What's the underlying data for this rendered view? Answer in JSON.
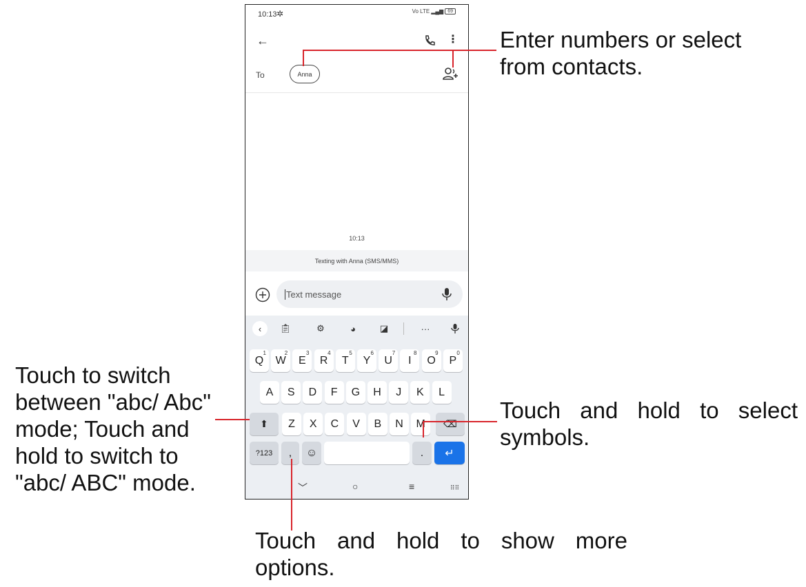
{
  "status_bar": {
    "time": "10:13",
    "network": "Vo LTE",
    "battery": "69"
  },
  "recipients": {
    "to_label": "To",
    "chip": "Anna"
  },
  "thread": {
    "timestamp": "10:13",
    "texting_with": "Texting with Anna (SMS/MMS)"
  },
  "composer": {
    "placeholder": "Text message"
  },
  "keyboard": {
    "row1": [
      "Q",
      "W",
      "E",
      "R",
      "T",
      "Y",
      "U",
      "I",
      "O",
      "P"
    ],
    "row1_digits": [
      "1",
      "2",
      "3",
      "4",
      "5",
      "6",
      "7",
      "8",
      "9",
      "0"
    ],
    "row2": [
      "A",
      "S",
      "D",
      "F",
      "G",
      "H",
      "J",
      "K",
      "L"
    ],
    "row3": [
      "Z",
      "X",
      "C",
      "V",
      "B",
      "N",
      "M"
    ],
    "symbols_key": "?123",
    "comma_key": ",",
    "period_key": "."
  },
  "annotations": {
    "top": "Enter numbers or select from contacts.",
    "right": "Touch and hold to select symbols.",
    "left": "Touch to switch between \"abc/ Abc\" mode; Touch and hold to switch to \"abc/ ABC\" mode.",
    "bottom": "Touch and hold to show more options."
  },
  "colors": {
    "annotation_line": "#d8232a",
    "enter_key": "#1a73e8"
  }
}
